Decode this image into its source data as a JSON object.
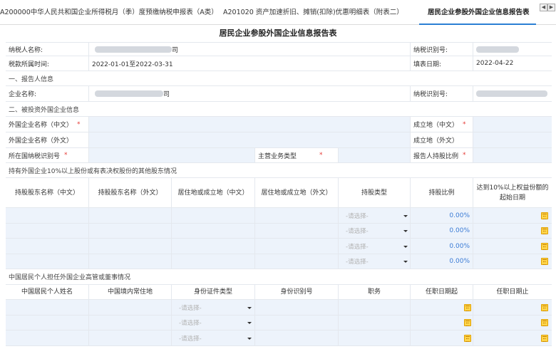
{
  "tabs": [
    {
      "label": "A200000中华人民共和国企业所得税月（季）度预缴纳税申报表（A类）"
    },
    {
      "label": "A201020 资产加速折旧、摊销(扣除)优惠明细表（附表二）"
    },
    {
      "label": "居民企业参股外国企业信息报告表"
    }
  ],
  "tab_nav": {
    "prev": "◀",
    "next": "▶"
  },
  "report": {
    "title": "居民企业参股外国企业信息报告表",
    "taxpayer_name_label": "纳税人名称:",
    "taxpayer_name_value": "",
    "taxpayer_name_suffix": "司",
    "taxpayer_id_label": "纳税识别号:",
    "tax_period_label": "税款所属时间:",
    "tax_period_value": "2022-01-01至2022-03-31",
    "fill_date_label": "填表日期:",
    "fill_date_value": "2022-04-22",
    "section1": "一、报告人信息",
    "company_name_label": "企业名称:",
    "company_name_suffix": "司",
    "company_tax_id_label": "纳税识别号:",
    "section2": "二、被投资外国企业信息",
    "foreign_name_cn_label": "外国企业名称（中文）",
    "foreign_name_en_label": "外国企业名称（外文）",
    "foreign_tax_id_label": "所在国纳税识别号",
    "main_business_label": "主营业务类型",
    "established_cn_label": "成立地（中文）",
    "established_en_label": "成立地（外文）",
    "reporter_ratio_label": "报告人持股比例",
    "required_mark": "*",
    "section3": "持有外国企业10%以上股份或有表决权股份的其他股东情况",
    "shareholder_headers": [
      "持股股东名称（中文）",
      "持股股东名称（外文）",
      "居住地或成立地（中文）",
      "居住地或成立地（外文）",
      "持股类型",
      "持股比例",
      "达到10%以上权益份额的起始日期"
    ],
    "shareholder_rows": [
      {
        "type_placeholder": "-请选择-",
        "ratio": "0.00%"
      },
      {
        "type_placeholder": "-请选择-",
        "ratio": "0.00%"
      },
      {
        "type_placeholder": "-请选择-",
        "ratio": "0.00%"
      },
      {
        "type_placeholder": "-请选择-",
        "ratio": "0.00%"
      }
    ],
    "section4": "中国居民个人担任外国企业高管或董事情况",
    "exec_headers": [
      "中国居民个人姓名",
      "中国境内常住地",
      "身份证件类型",
      "身份识别号",
      "职务",
      "任职日期起",
      "任职日期止"
    ],
    "exec_rows": [
      {
        "id_type_placeholder": "-请选择-"
      },
      {
        "id_type_placeholder": "-请选择-"
      },
      {
        "id_type_placeholder": "-请选择-"
      }
    ]
  },
  "colors": {
    "accent": "#2b7fd4",
    "input_bg": "#edf3fb",
    "required": "#e53935",
    "percent": "#3a7bd5",
    "calendar": "#ffd54a"
  },
  "icons": {
    "calendar": "calendar-icon",
    "dropdown": "chevron-down-icon"
  }
}
